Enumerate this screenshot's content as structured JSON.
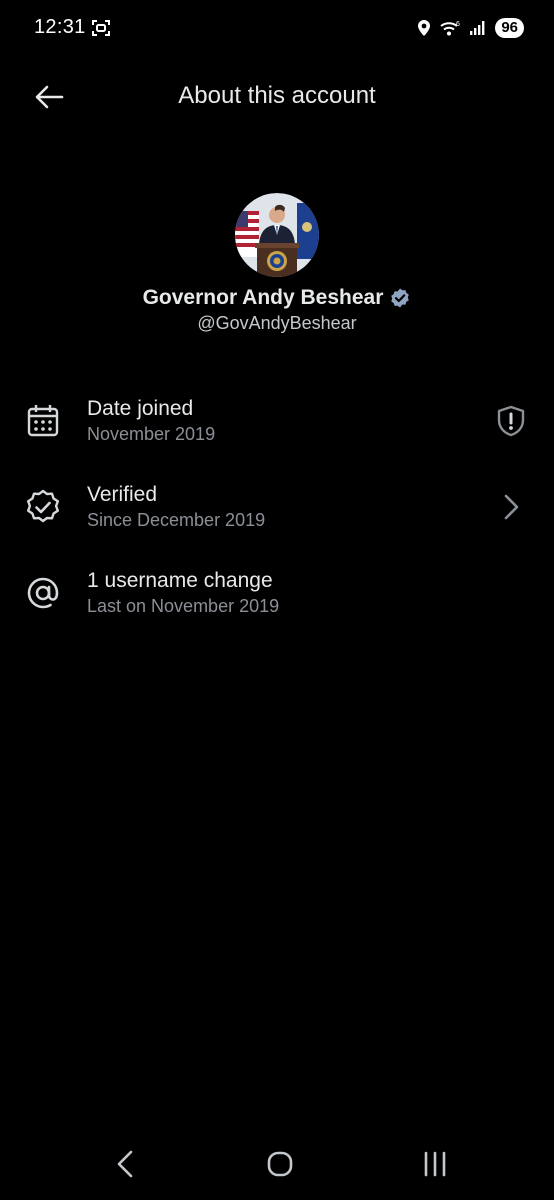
{
  "status_bar": {
    "time": "12:31",
    "battery_level": "96",
    "icons": [
      "screenshot-scan-icon",
      "location-icon",
      "wifi-icon",
      "signal-icon"
    ]
  },
  "header": {
    "title": "About this account",
    "back_icon": "arrow-left-icon"
  },
  "profile": {
    "display_name": "Governor Andy Beshear",
    "handle": "@GovAndyBeshear",
    "verified": true,
    "verified_color": "#8fa4c0"
  },
  "info_items": [
    {
      "icon": "calendar-icon",
      "title": "Date joined",
      "subtitle": "November 2019",
      "trailing_icon": "shield-alert-icon"
    },
    {
      "icon": "verified-badge-outline-icon",
      "title": "Verified",
      "subtitle": "Since December 2019",
      "trailing_icon": "chevron-right-icon"
    },
    {
      "icon": "at-sign-icon",
      "title": "1 username change",
      "subtitle": "Last on November 2019",
      "trailing_icon": ""
    }
  ],
  "nav_bar": {
    "buttons": [
      "back-nav-icon",
      "home-nav-icon",
      "recents-nav-icon"
    ]
  },
  "colors": {
    "background": "#000000",
    "primary_text": "#e7e9ea",
    "secondary_text": "#8b9096",
    "icon": "#d6d9dc"
  }
}
